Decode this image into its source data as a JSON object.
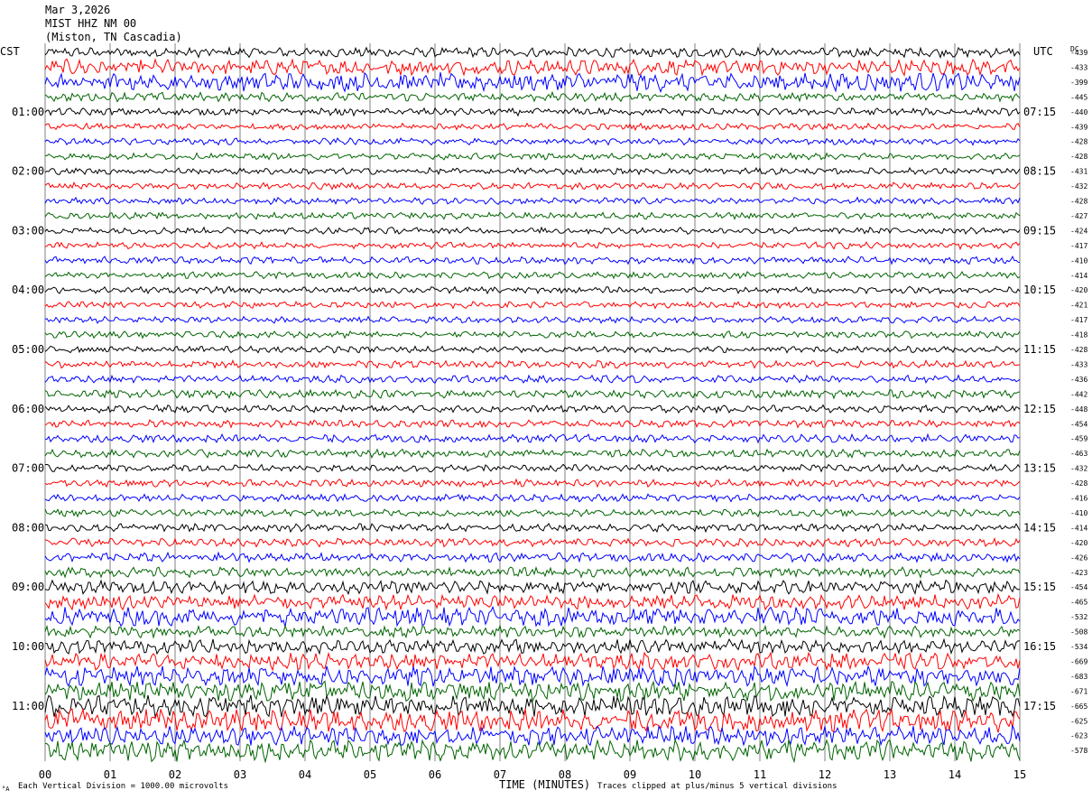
{
  "header": {
    "date": "Mar 3,2026",
    "station": "MIST HHZ NM 00",
    "location": "(Miston, TN Cascadia)"
  },
  "left_timezone": "CST",
  "right_timezone": "UTC",
  "dc_label": "DC",
  "footer": {
    "scale_note": "Each Vertical Division = 1000.00 microvolts",
    "clip_note": "Traces clipped at plus/minus 5 vertical divisions",
    "corner_mark": "°A"
  },
  "colors": {
    "trace_cycle": [
      "#000000",
      "#ff0000",
      "#0000ff",
      "#006400"
    ],
    "grid": "#808080"
  },
  "chart_data": {
    "type": "line",
    "title": "",
    "xlabel": "TIME (MINUTES)",
    "xlim": [
      0,
      15
    ],
    "x_ticks": [
      "00",
      "01",
      "02",
      "03",
      "04",
      "05",
      "06",
      "07",
      "08",
      "09",
      "10",
      "11",
      "12",
      "13",
      "14",
      "15"
    ],
    "left_hour_labels": [
      "01:00",
      "02:00",
      "03:00",
      "04:00",
      "05:00",
      "06:00",
      "07:00",
      "08:00",
      "09:00",
      "10:00",
      "11:00"
    ],
    "right_hour_labels": [
      "07:15",
      "08:15",
      "09:15",
      "10:15",
      "11:15",
      "12:15",
      "13:15",
      "14:15",
      "15:15",
      "16:15",
      "17:15"
    ],
    "dc_offsets": [
      -439,
      -433,
      -399,
      -445,
      -440,
      -439,
      -428,
      -428,
      -431,
      -432,
      -428,
      -427,
      -424,
      -417,
      -410,
      -414,
      -420,
      -421,
      -417,
      -418,
      -428,
      -433,
      -436,
      -442,
      -448,
      -454,
      -459,
      -463,
      -432,
      -428,
      -416,
      -410,
      -414,
      -420,
      -426,
      -423,
      -454,
      -465,
      -532,
      -508,
      -534,
      -669,
      -683,
      -671,
      -665,
      -625,
      -623,
      -578
    ],
    "trace_count": 48,
    "traces_per_hour": 4,
    "trace_amplitude_divisions": [
      1.2,
      1.9,
      2.3,
      1.1,
      0.9,
      0.8,
      0.8,
      0.8,
      0.8,
      0.8,
      0.8,
      0.8,
      0.8,
      0.8,
      0.9,
      0.8,
      0.8,
      0.8,
      0.8,
      0.8,
      0.8,
      0.9,
      0.9,
      1.0,
      0.9,
      0.9,
      1.0,
      1.0,
      0.9,
      0.9,
      0.9,
      0.9,
      1.0,
      1.0,
      1.1,
      1.2,
      1.6,
      1.8,
      2.3,
      1.4,
      1.7,
      2.0,
      2.4,
      2.4,
      2.6,
      2.8,
      2.4,
      2.6
    ]
  }
}
